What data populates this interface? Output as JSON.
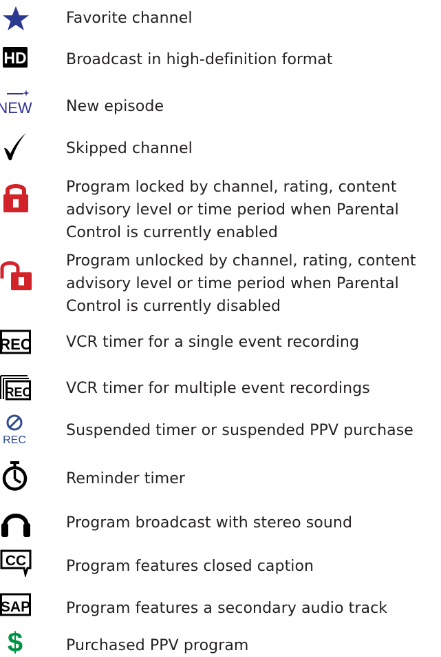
{
  "legend": {
    "items": [
      {
        "icon": "star-icon",
        "label": "Favorite channel"
      },
      {
        "icon": "hd-icon",
        "label": "Broadcast in high-definition format",
        "icon_text": "HD"
      },
      {
        "icon": "new-icon",
        "label": "New episode",
        "icon_text": "NEW"
      },
      {
        "icon": "checkmark-icon",
        "label": "Skipped channel"
      },
      {
        "icon": "lock-closed-icon",
        "label": "Program locked by channel, rating, content\nadvisory level or time period when Parental\nControl is currently enabled"
      },
      {
        "icon": "lock-open-icon",
        "label": "Program unlocked by channel, rating, content\nadvisory level or time period when Parental\nControl is currently disabled"
      },
      {
        "icon": "rec-icon",
        "label": "VCR timer for a single event recording",
        "icon_text": "REC"
      },
      {
        "icon": "rec-multiple-icon",
        "label": "VCR timer for multiple event recordings",
        "icon_text": "REC"
      },
      {
        "icon": "rec-suspended-icon",
        "label": "Suspended timer or suspended PPV purchase",
        "icon_text": "REC"
      },
      {
        "icon": "stopwatch-icon",
        "label": "Reminder timer"
      },
      {
        "icon": "headphones-icon",
        "label": "Program broadcast with stereo sound"
      },
      {
        "icon": "cc-icon",
        "label": "Program features closed caption",
        "icon_text": "CC"
      },
      {
        "icon": "sap-icon",
        "label": "Program features a secondary audio track",
        "icon_text": "SAP"
      },
      {
        "icon": "dollar-icon",
        "label": "Purchased PPV program",
        "icon_text": "$"
      }
    ]
  },
  "colors": {
    "text": "#231f20",
    "star": "#2b3990",
    "new": "#2e3192",
    "lock": "#d2232a",
    "suspended": "#2e4b8f",
    "dollar": "#009345",
    "icon_dark": "#000000"
  }
}
